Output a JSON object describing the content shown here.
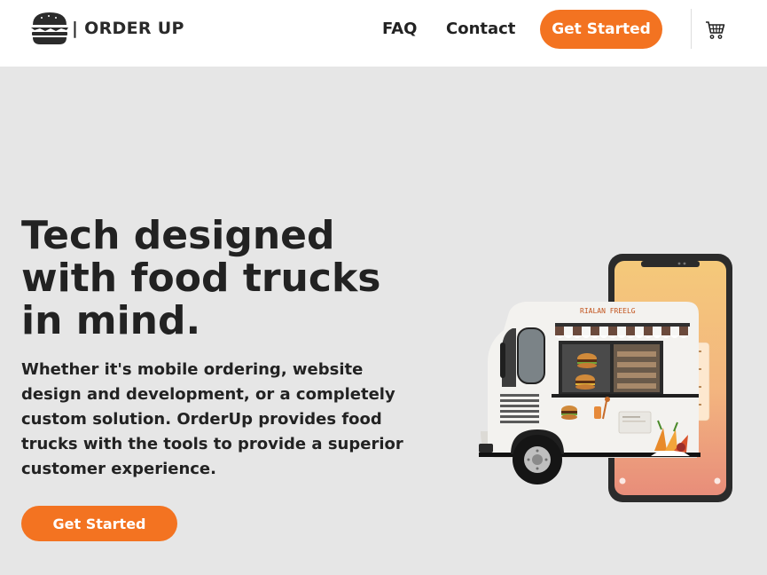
{
  "header": {
    "brand": "| ORDER UP",
    "nav": {
      "faq": "FAQ",
      "contact": "Contact"
    },
    "cta_label": "Get Started"
  },
  "hero": {
    "title_lines": [
      "Tech designed",
      "with food trucks",
      "in mind."
    ],
    "description_lines": [
      "Whether it's mobile ordering, website",
      "design and development, or a completely",
      "custom solution. OrderUp provides food",
      "trucks with the tools to provide a superior",
      "customer experience."
    ],
    "cta_label": "Get Started",
    "illustration_sign": "RIALAN FREELG"
  },
  "icons": {
    "logo": "burger-icon",
    "cart": "shopping-cart-icon"
  },
  "colors": {
    "accent": "#f37321",
    "background": "#e6e6e6",
    "header": "#ffffff",
    "text": "#222222"
  }
}
